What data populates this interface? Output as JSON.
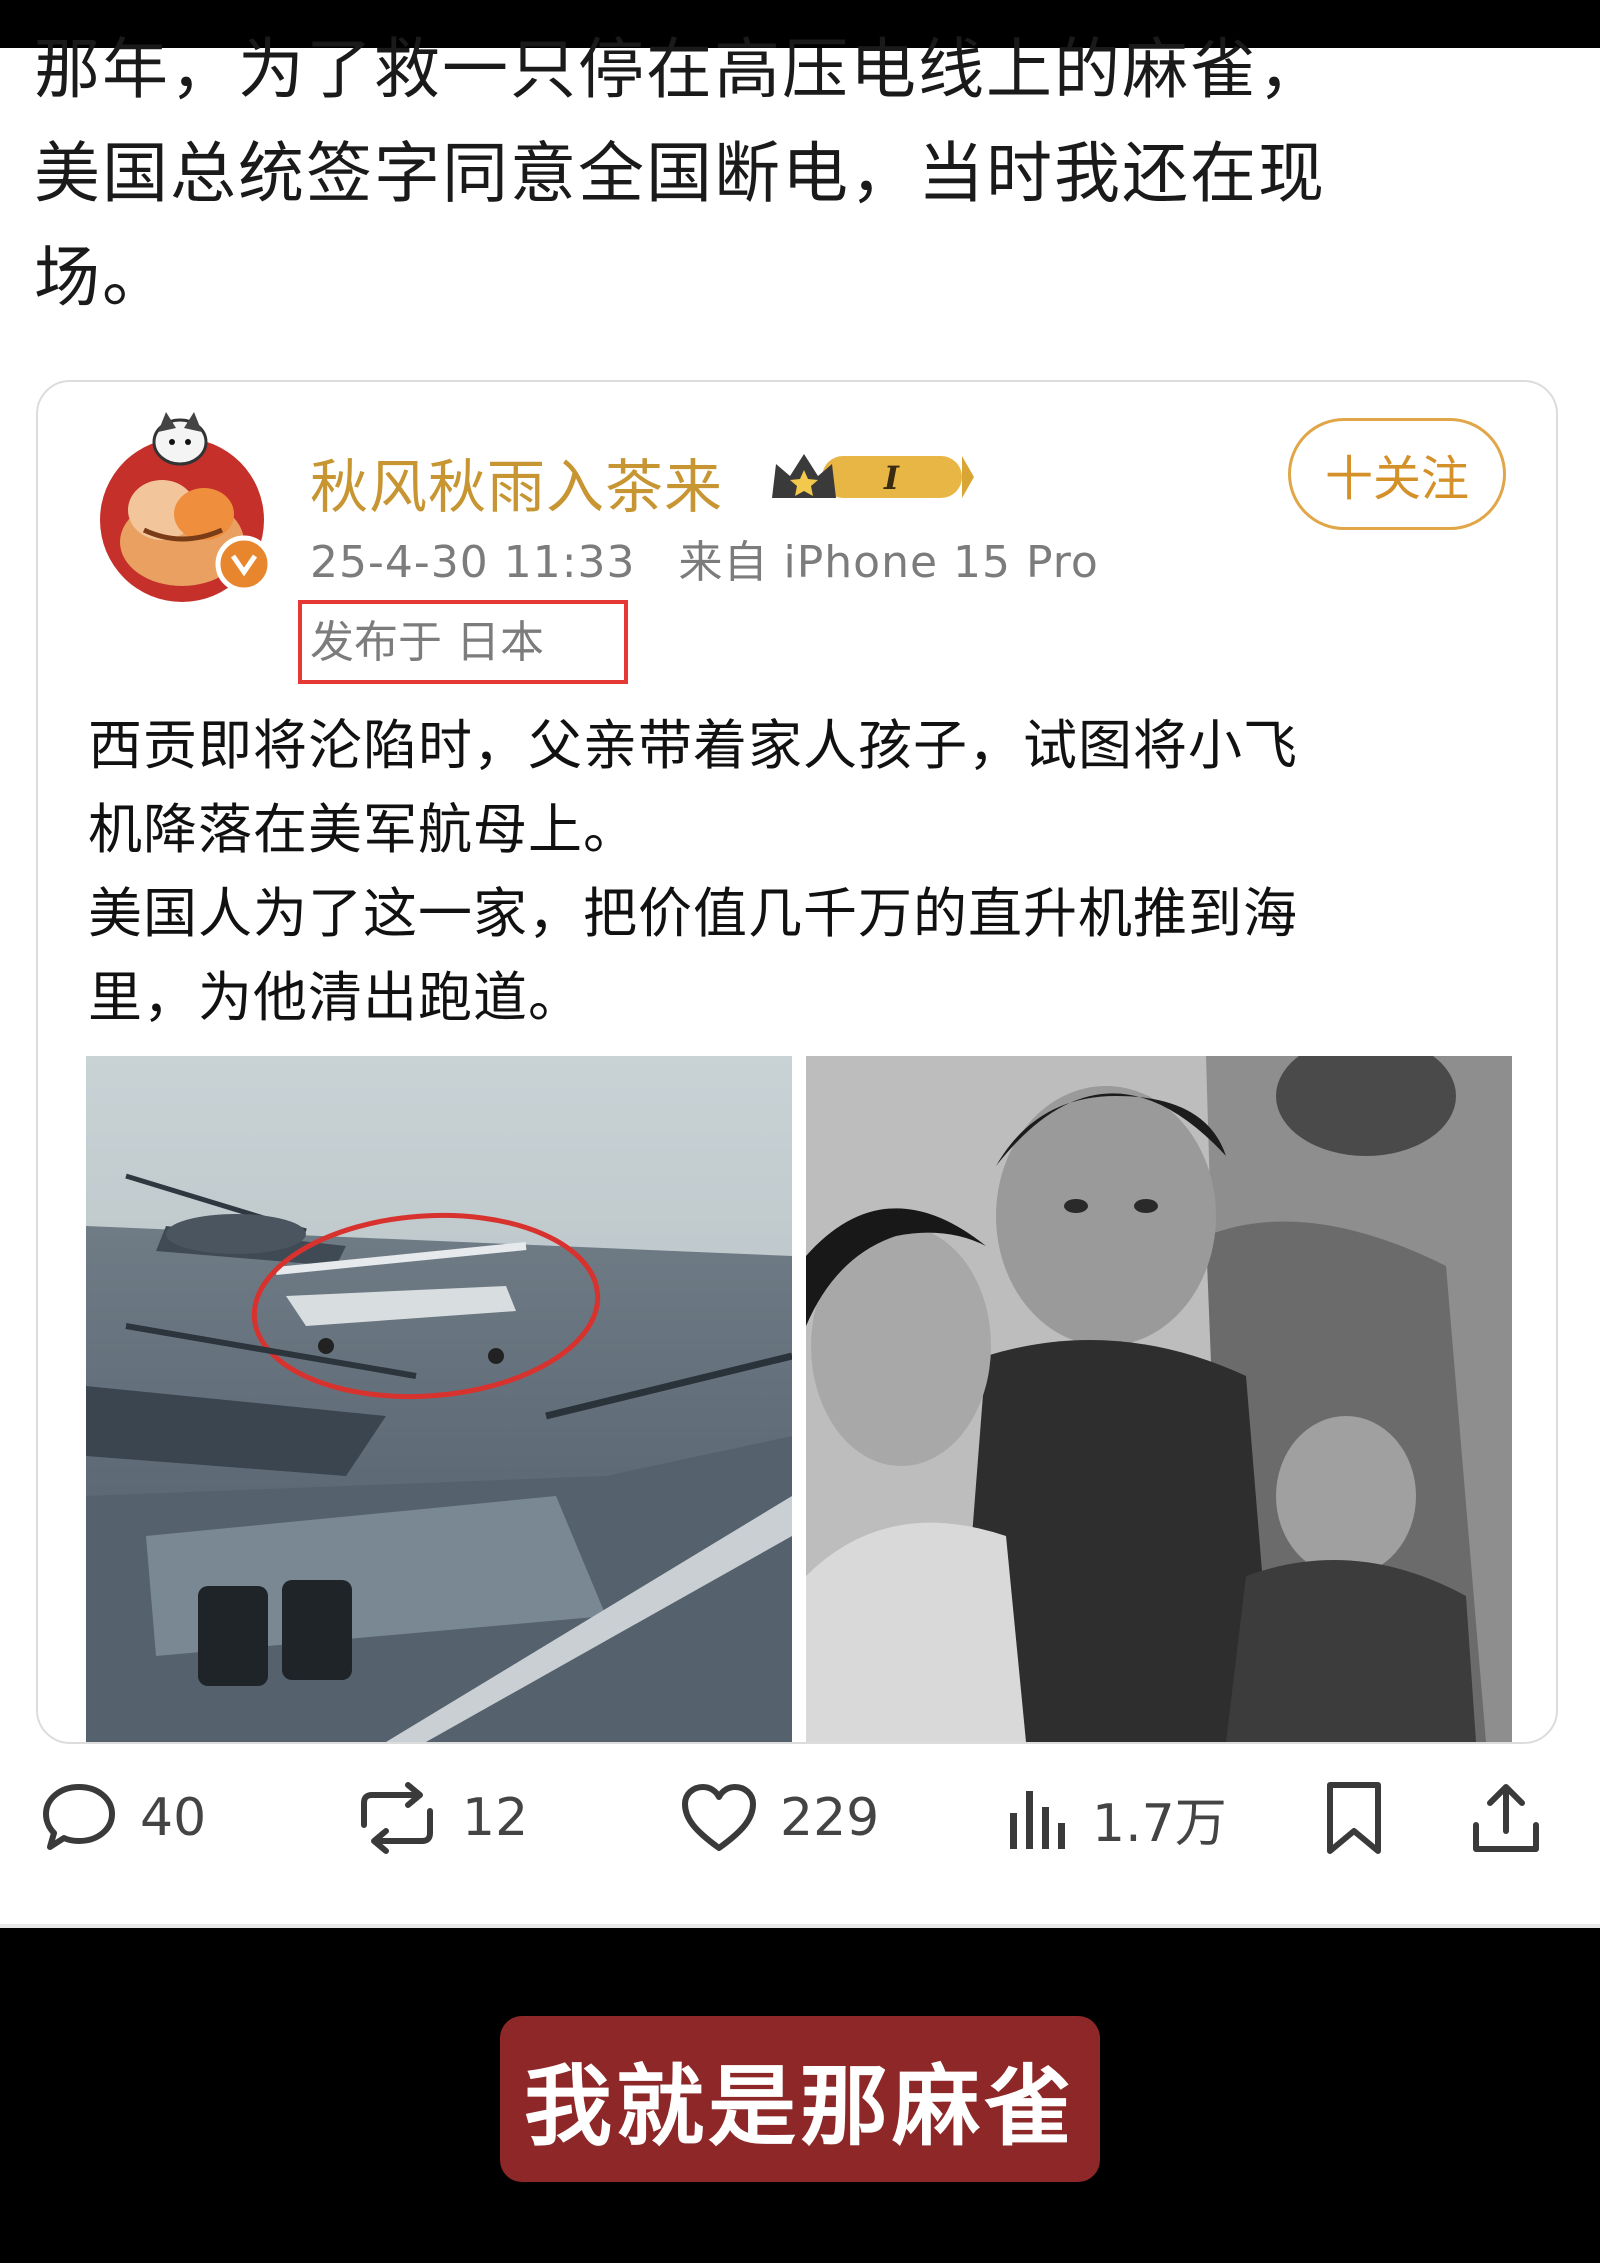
{
  "post": {
    "text_lines": [
      "那年，为了救一只停在高压电线上的麻雀，",
      "美国总统签字同意全国断电，当时我还在现",
      "场。"
    ]
  },
  "quoted_card": {
    "username": "秋风秋雨入茶来",
    "level_badge": "I",
    "follow_label": "十关注",
    "timestamp": "25-4-30 11:33",
    "source": "来自 iPhone 15 Pro",
    "ip_location": "发布于 日本",
    "text_lines": [
      "西贡即将沦陷时，父亲带着家人孩子，试图将小飞",
      "机降落在美军航母上。",
      "美国人为了这一家，把价值几千万的直升机推到海",
      "里，为他清出跑道。"
    ],
    "photos": [
      {
        "icon": "aircraft-carrier-photo"
      },
      {
        "icon": "family-photo"
      }
    ]
  },
  "actions": {
    "comments": "40",
    "reposts": "12",
    "likes": "229",
    "views": "1.7万"
  },
  "caption": "我就是那麻雀",
  "colors": {
    "username": "#c79532",
    "follow": "#d4912a",
    "highlight_box": "#e53935",
    "caption_bg": "#8d2728"
  }
}
